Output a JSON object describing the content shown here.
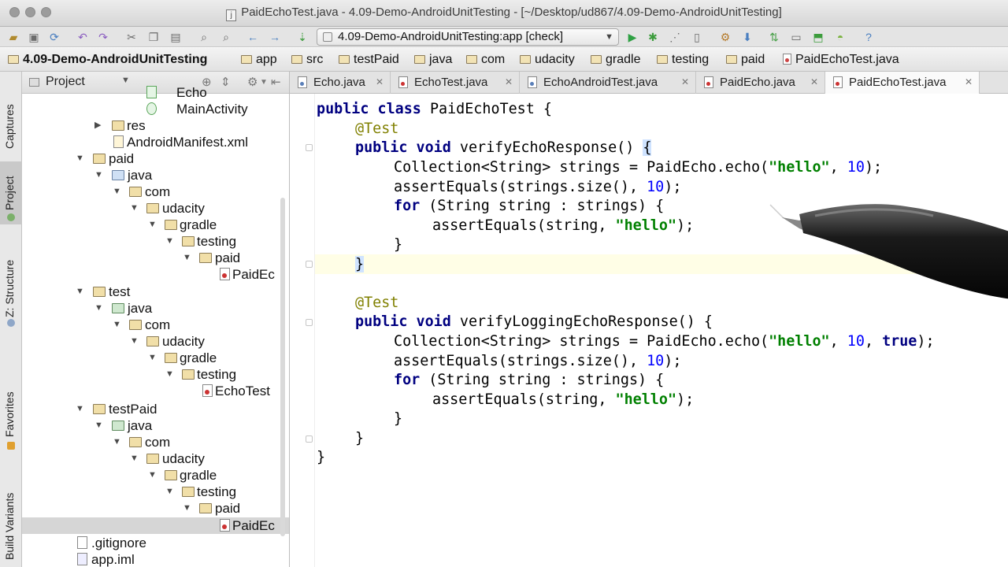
{
  "window": {
    "title": "PaidEchoTest.java - 4.09-Demo-AndroidUnitTesting - [~/Desktop/ud867/4.09-Demo-AndroidUnitTesting]",
    "file_icon_letter": "j"
  },
  "toolbar": {
    "run_configuration": "4.09-Demo-AndroidUnitTesting:app [check]"
  },
  "breadcrumb": [
    "4.09-Demo-AndroidUnitTesting",
    "app",
    "src",
    "testPaid",
    "java",
    "com",
    "udacity",
    "gradle",
    "testing",
    "paid",
    "PaidEchoTest.java"
  ],
  "left_tool_strip": {
    "captures": "Captures",
    "project": "Project",
    "structure": "Z: Structure",
    "favorites": "Favorites",
    "build_variants": "Build Variants"
  },
  "project_panel": {
    "header_label": "Project",
    "tree": [
      {
        "label": "Echo",
        "depth": 7
      },
      {
        "label": "MainActivity",
        "depth": 7
      },
      {
        "label": "res",
        "depth": 5
      },
      {
        "label": "AndroidManifest.xml",
        "depth": 5
      },
      {
        "label": "paid",
        "depth": 4
      },
      {
        "label": "java",
        "depth": 5
      },
      {
        "label": "com",
        "depth": 6
      },
      {
        "label": "udacity",
        "depth": 7
      },
      {
        "label": "gradle",
        "depth": 8
      },
      {
        "label": "testing",
        "depth": 9
      },
      {
        "label": "paid",
        "depth": 10
      },
      {
        "label": "PaidEc",
        "depth": 11
      },
      {
        "label": "test",
        "depth": 4
      },
      {
        "label": "java",
        "depth": 5
      },
      {
        "label": "com",
        "depth": 6
      },
      {
        "label": "udacity",
        "depth": 7
      },
      {
        "label": "gradle",
        "depth": 8
      },
      {
        "label": "testing",
        "depth": 9
      },
      {
        "label": "EchoTest",
        "depth": 10
      },
      {
        "label": "testPaid",
        "depth": 4
      },
      {
        "label": "java",
        "depth": 5
      },
      {
        "label": "com",
        "depth": 6
      },
      {
        "label": "udacity",
        "depth": 7
      },
      {
        "label": "gradle",
        "depth": 8
      },
      {
        "label": "testing",
        "depth": 9
      },
      {
        "label": "paid",
        "depth": 10
      },
      {
        "label": "PaidEc",
        "depth": 11
      },
      {
        "label": ".gitignore",
        "depth": 3
      },
      {
        "label": "app.iml",
        "depth": 3
      }
    ]
  },
  "editor_tabs": [
    {
      "label": "Echo.java",
      "active": false
    },
    {
      "label": "EchoTest.java",
      "active": false
    },
    {
      "label": "EchoAndroidTest.java",
      "active": false
    },
    {
      "label": "PaidEcho.java",
      "active": false
    },
    {
      "label": "PaidEchoTest.java",
      "active": true
    }
  ],
  "code": {
    "l1": {
      "kw": "public class",
      "rest": " PaidEchoTest {"
    },
    "l2": "@Test",
    "l3": {
      "kw": "public void",
      "rest": " verifyEchoResponse() ",
      "brace": "{"
    },
    "l4": {
      "pre": "Collection<String> strings = PaidEcho.echo(",
      "str": "\"hello\"",
      "mid": ", ",
      "num": "10",
      "post": ");"
    },
    "l5": {
      "pre": "assertEquals(strings.size(), ",
      "num": "10",
      "post": ");"
    },
    "l6": {
      "kw": "for",
      "rest": " (String string : strings) {"
    },
    "l7": {
      "pre": "assertEquals(string, ",
      "str": "\"hello\"",
      "post": ");"
    },
    "l8": "}",
    "l9": "}",
    "l10": "@Test",
    "l11": {
      "kw": "public void",
      "rest": " verifyLoggingEchoResponse() {"
    },
    "l12": {
      "pre": "Collection<String> strings = PaidEcho.echo(",
      "str": "\"hello\"",
      "mid": ", ",
      "num": "10",
      "mid2": ", ",
      "kw": "true",
      "post": ");"
    },
    "l13": {
      "pre": "assertEquals(strings.size(), ",
      "num": "10",
      "post": ");"
    },
    "l14": {
      "kw": "for",
      "rest": " (String string : strings) {"
    },
    "l15": {
      "pre": "assertEquals(string, ",
      "str": "\"hello\"",
      "post": ");"
    },
    "l16": "}",
    "l17": "}",
    "l18": "}"
  }
}
